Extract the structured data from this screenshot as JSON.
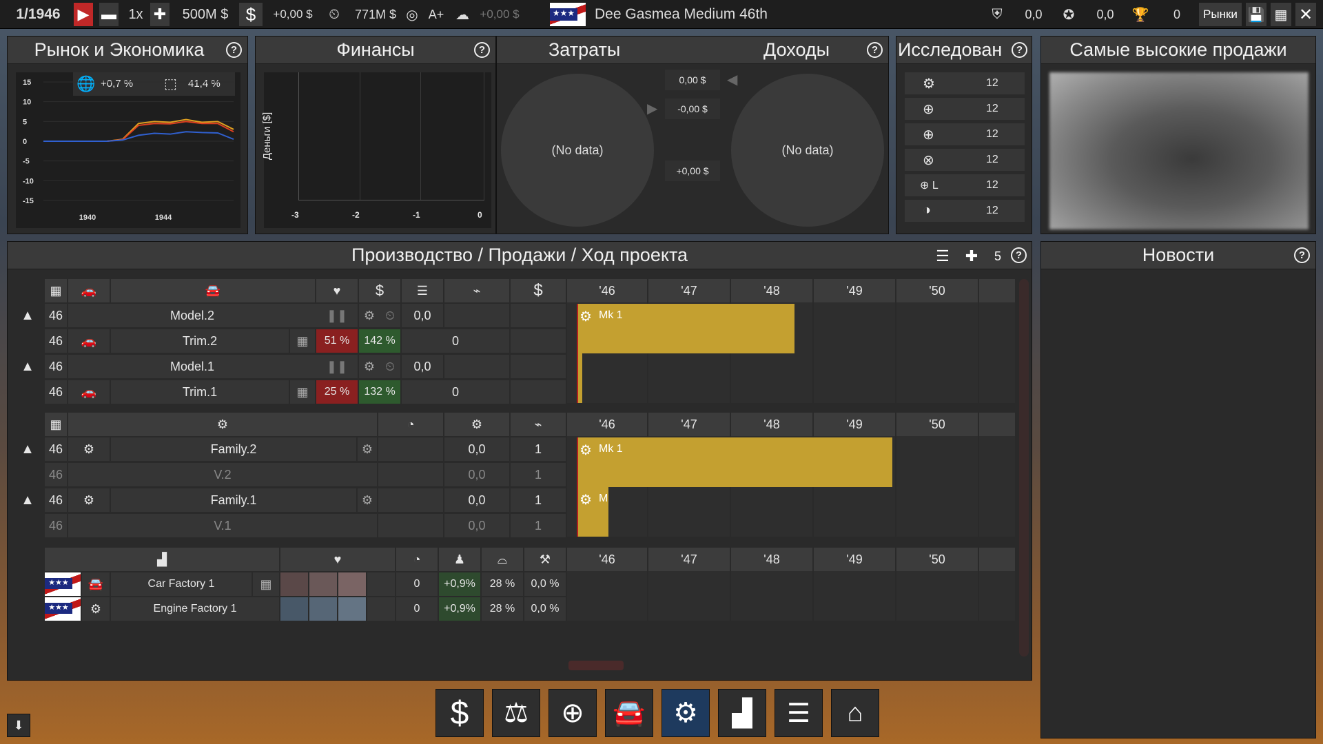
{
  "topbar": {
    "date": "1/1946",
    "speed": "1x",
    "money": "500M $",
    "delta1": "+0,00 $",
    "loan": "771M $",
    "rating": "A+",
    "delta2": "+0,00 $",
    "company": "Dee Gasmea Medium 46th",
    "s1": "0,0",
    "s2": "0,0",
    "s3": "0",
    "markets": "Рынки"
  },
  "market": {
    "title": "Рынок и Экономика",
    "gdp": "+0,7 %",
    "share": "41,4 %",
    "yticks": [
      "15",
      "10",
      "5",
      "0",
      "-5",
      "-10",
      "-15"
    ],
    "xticks": [
      "1940",
      "1944"
    ]
  },
  "finance": {
    "title": "Финансы",
    "ylabel": "Деньги [$]",
    "xticks": [
      "-3",
      "-2",
      "-1",
      "0"
    ]
  },
  "costs": {
    "title": "Затраты",
    "income_title": "Доходы",
    "nodata": "(No data)",
    "v1": "0,00 $",
    "v2": "-0,00 $",
    "v3": "+0,00 $"
  },
  "research": {
    "title": "Исследован",
    "values": [
      "12",
      "12",
      "12",
      "12",
      "12",
      "12"
    ]
  },
  "topsales": {
    "title": "Самые высокие продажи"
  },
  "news": {
    "title": "Новости"
  },
  "production": {
    "title": "Производство / Продажи / Ход проекта",
    "count": "5",
    "years": [
      "'46",
      "'47",
      "'48",
      "'49",
      "'50"
    ],
    "cars": [
      {
        "year": "46",
        "name": "Model.2",
        "v": "0,0",
        "bar": "Mk 1"
      },
      {
        "year": "46",
        "name": "Trim.2",
        "p1": "51 %",
        "p2": "142 %",
        "v": "0"
      },
      {
        "year": "46",
        "name": "Model.1",
        "v": "0,0"
      },
      {
        "year": "46",
        "name": "Trim.1",
        "p1": "25 %",
        "p2": "132 %",
        "v": "0"
      }
    ],
    "engines": [
      {
        "year": "46",
        "name": "Family.2",
        "a": "0,0",
        "b": "1",
        "bar": "Mk 1"
      },
      {
        "year": "46",
        "name": "V.2",
        "a": "0,0",
        "b": "1"
      },
      {
        "year": "46",
        "name": "Family.1",
        "a": "0,0",
        "b": "1",
        "bar": "M"
      },
      {
        "year": "46",
        "name": "V.1",
        "a": "0,0",
        "b": "1"
      }
    ],
    "factories": [
      {
        "name": "Car Factory 1",
        "a": "0",
        "b": "+0,9%",
        "c": "28 %",
        "d": "0,0 %"
      },
      {
        "name": "Engine Factory 1",
        "a": "0",
        "b": "+0,9%",
        "c": "28 %",
        "d": "0,0 %"
      }
    ]
  },
  "chart_data": {
    "type": "line",
    "x": [
      1936,
      1937,
      1938,
      1939,
      1940,
      1941,
      1942,
      1943,
      1944,
      1945,
      1946
    ],
    "xticks": [
      "1940",
      "1944"
    ],
    "ylim": [
      -15,
      15
    ],
    "series": [
      {
        "color": "#e0a020",
        "values": [
          0,
          0,
          0,
          0,
          0,
          0.5,
          4.5,
          5,
          4.8,
          5.5,
          4.8,
          5,
          3
        ]
      },
      {
        "color": "#e04020",
        "values": [
          0,
          0,
          0,
          0,
          0,
          0.4,
          4,
          4.5,
          4.4,
          5,
          4.5,
          4.5,
          2.4
        ]
      },
      {
        "color": "#3060d0",
        "values": [
          0,
          0,
          0,
          0,
          0,
          0.3,
          1.5,
          2,
          1.8,
          2.4,
          2.2,
          2.1,
          0.5
        ]
      }
    ]
  }
}
